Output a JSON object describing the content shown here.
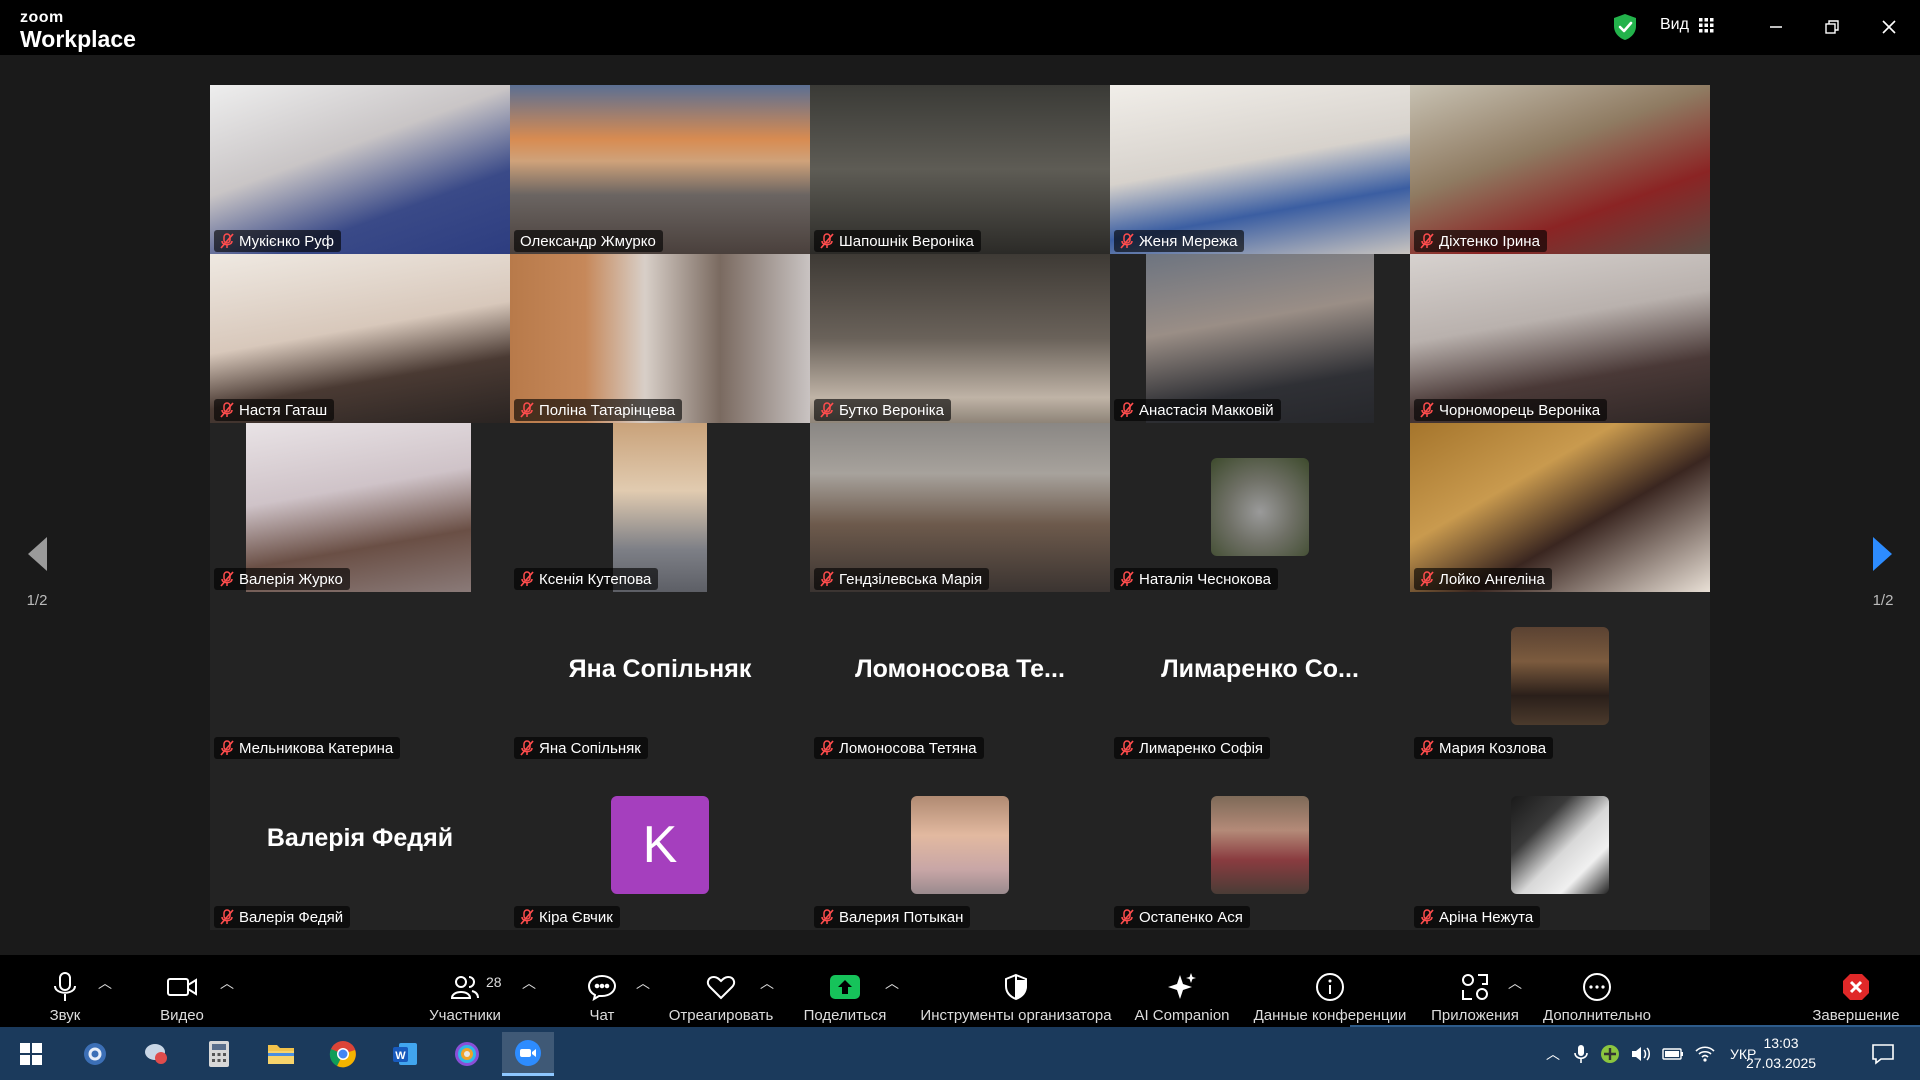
{
  "app": {
    "brand_small": "zoom",
    "brand_large": "Workplace"
  },
  "titlebar": {
    "view_label": "Вид"
  },
  "pager": {
    "prev_page": "1/2",
    "next_page": "1/2"
  },
  "participants": [
    {
      "name": "Мукієнко Руф",
      "muted": true,
      "type": "video"
    },
    {
      "name": "Олександр Жмурко",
      "muted": false,
      "type": "video",
      "active_speaker": true
    },
    {
      "name": "Шапошнік Вероніка",
      "muted": true,
      "type": "video"
    },
    {
      "name": "Женя Мережа",
      "muted": true,
      "type": "video"
    },
    {
      "name": "Діхтенко Ірина",
      "muted": true,
      "type": "video"
    },
    {
      "name": "Настя Гаташ",
      "muted": true,
      "type": "video"
    },
    {
      "name": "Поліна Татарінцева",
      "muted": true,
      "type": "video"
    },
    {
      "name": "Бутко Вероніка",
      "muted": true,
      "type": "video"
    },
    {
      "name": "Анастасія Макковій",
      "muted": true,
      "type": "video"
    },
    {
      "name": "Чорноморець Вероніка",
      "muted": true,
      "type": "video"
    },
    {
      "name": "Валерія Журко",
      "muted": true,
      "type": "video"
    },
    {
      "name": "Ксенія Кутепова",
      "muted": true,
      "type": "video"
    },
    {
      "name": "Гендзілевська Марія",
      "muted": true,
      "type": "video"
    },
    {
      "name": "Наталія Чеснокова",
      "muted": true,
      "type": "avatar"
    },
    {
      "name": "Лойко Ангеліна",
      "muted": true,
      "type": "video"
    },
    {
      "name": "Мельникова Катерина",
      "muted": true,
      "type": "blank"
    },
    {
      "name": "Яна Сопільняк",
      "muted": true,
      "type": "name",
      "display": "Яна Сопільняк"
    },
    {
      "name": "Ломоносова Тетяна",
      "muted": true,
      "type": "name",
      "display": "Ломоносова  Те..."
    },
    {
      "name": "Лимаренко Софія",
      "muted": true,
      "type": "name",
      "display": "Лимаренко  Со..."
    },
    {
      "name": "Мария Козлова",
      "muted": true,
      "type": "avatar"
    },
    {
      "name": "Валерія Федяй",
      "muted": true,
      "type": "name",
      "display": "Валерія Федяй"
    },
    {
      "name": "Кіра Євчик",
      "muted": true,
      "type": "letter",
      "letter": "K"
    },
    {
      "name": "Валерия Потыкан",
      "muted": true,
      "type": "avatar"
    },
    {
      "name": "Остапенко Ася",
      "muted": true,
      "type": "avatar"
    },
    {
      "name": "Аріна Нежута",
      "muted": true,
      "type": "avatar"
    }
  ],
  "toolbar": {
    "audio": "Звук",
    "video": "Видео",
    "participants": "Участники",
    "participants_count": "28",
    "chat": "Чат",
    "react": "Отреагировать",
    "share": "Поделиться",
    "host_tools": "Инструменты организатора",
    "ai_companion": "AI Companion",
    "meeting_info": "Данные конференции",
    "apps": "Приложения",
    "more": "Дополнительно",
    "end": "Завершение"
  },
  "taskbar": {
    "language": "УКР",
    "time": "13:03",
    "date": "27.03.2025"
  },
  "colors": {
    "active_speaker": "#23d18b",
    "share_green": "#16c35a",
    "end_red": "#e02828",
    "avatar_purple": "#a53fbe",
    "taskbar": "#1b3a5c"
  }
}
